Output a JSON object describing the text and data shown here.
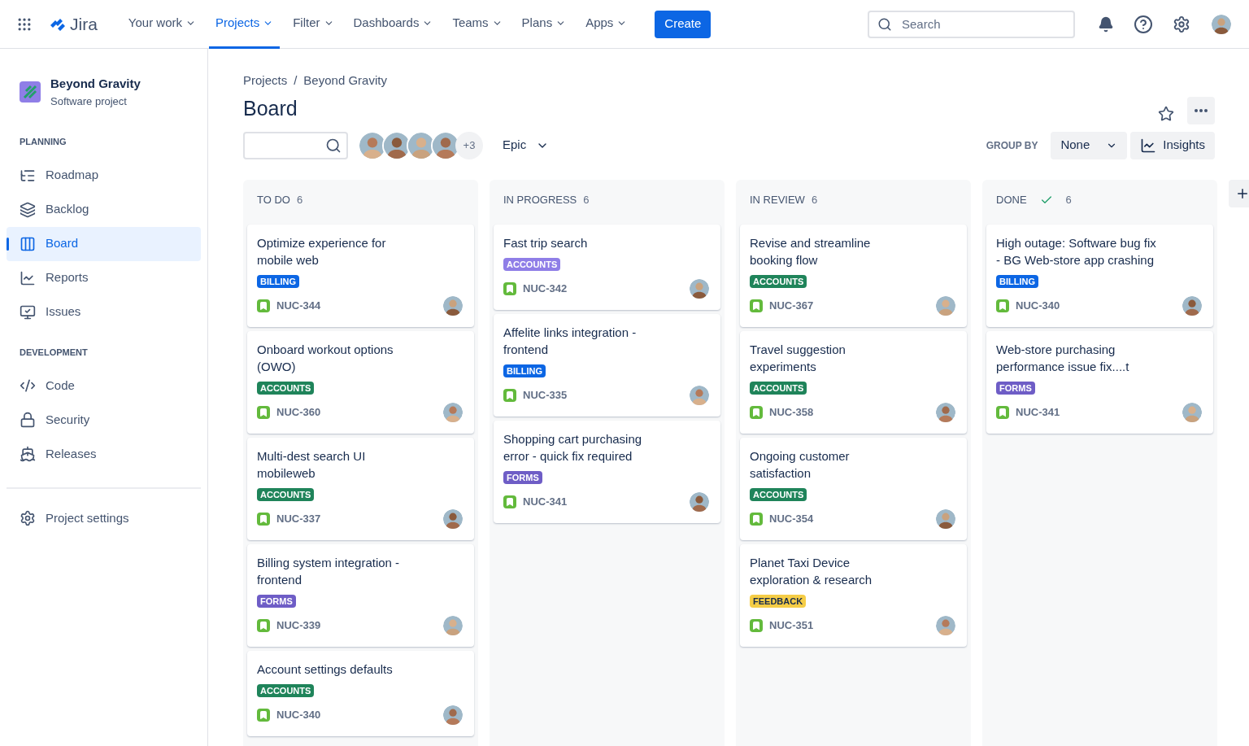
{
  "topnav": {
    "product": "Jira",
    "items": [
      {
        "label": "Your work",
        "selected": false
      },
      {
        "label": "Projects",
        "selected": true
      },
      {
        "label": "Filter",
        "selected": false
      },
      {
        "label": "Dashboards",
        "selected": false
      },
      {
        "label": "Teams",
        "selected": false
      },
      {
        "label": "Plans",
        "selected": false
      },
      {
        "label": "Apps",
        "selected": false
      }
    ],
    "create": "Create",
    "search": {
      "placeholder": "Search"
    }
  },
  "sidebar": {
    "project": {
      "name": "Beyond Gravity",
      "type": "Software project"
    },
    "sections": [
      {
        "heading": "PLANNING",
        "items": [
          {
            "label": "Roadmap",
            "kind": "roadmap",
            "selected": false
          },
          {
            "label": "Backlog",
            "kind": "backlog",
            "selected": false
          },
          {
            "label": "Board",
            "kind": "board",
            "selected": true
          },
          {
            "label": "Reports",
            "kind": "reports",
            "selected": false
          },
          {
            "label": "Issues",
            "kind": "issues",
            "selected": false
          }
        ]
      },
      {
        "heading": "DEVELOPMENT",
        "items": [
          {
            "label": "Code",
            "kind": "code",
            "selected": false
          },
          {
            "label": "Security",
            "kind": "security",
            "selected": false
          },
          {
            "label": "Releases",
            "kind": "releases",
            "selected": false
          }
        ]
      }
    ],
    "settings": "Project settings"
  },
  "breadcrumbs": [
    "Projects",
    "Beyond Gravity"
  ],
  "breadcrumb_separator": "/",
  "title": "Board",
  "toolbar": {
    "more_avatars": "+3",
    "epic": "Epic",
    "group_by_label": "GROUP BY",
    "group_by": "None",
    "insights": "Insights"
  },
  "columns": [
    {
      "name": "TO DO",
      "count": "6",
      "complete": false,
      "cards": [
        {
          "title": "Optimize experience for mobile web",
          "tag": {
            "label": "BILLING",
            "color": "#0c66e4"
          },
          "key": "NUC-344"
        },
        {
          "title": "Onboard workout options (OWO)",
          "tag": {
            "label": "ACCOUNTS",
            "color": "#1f845a"
          },
          "key": "NUC-360"
        },
        {
          "title": "Multi-dest search UI mobileweb",
          "tag": {
            "label": "ACCOUNTS",
            "color": "#1f845a"
          },
          "key": "NUC-337"
        },
        {
          "title": "Billing system integration - frontend",
          "tag": {
            "label": "FORMS",
            "color": "#6e5dc6"
          },
          "key": "NUC-339"
        },
        {
          "title": "Account settings defaults",
          "tag": {
            "label": "ACCOUNTS",
            "color": "#1f845a"
          },
          "key": "NUC-340"
        }
      ]
    },
    {
      "name": "IN PROGRESS",
      "count": "6",
      "complete": false,
      "cards": [
        {
          "title": "Fast trip search",
          "tag": {
            "label": "ACCOUNTS",
            "color": "#8f7ee7"
          },
          "key": "NUC-342"
        },
        {
          "title": "Affelite links integration - frontend",
          "tag": {
            "label": "BILLING",
            "color": "#0c66e4"
          },
          "key": "NUC-335"
        },
        {
          "title": "Shopping cart purchasing error - quick fix required",
          "tag": {
            "label": "FORMS",
            "color": "#6e5dc6"
          },
          "key": "NUC-341"
        }
      ]
    },
    {
      "name": "IN REVIEW",
      "count": "6",
      "complete": false,
      "cards": [
        {
          "title": "Revise and streamline booking flow",
          "tag": {
            "label": "ACCOUNTS",
            "color": "#1f845a"
          },
          "key": "NUC-367"
        },
        {
          "title": "Travel suggestion experiments",
          "tag": {
            "label": "ACCOUNTS",
            "color": "#1f845a"
          },
          "key": "NUC-358"
        },
        {
          "title": "Ongoing customer satisfaction",
          "tag": {
            "label": "ACCOUNTS",
            "color": "#1f845a"
          },
          "key": "NUC-354"
        },
        {
          "title": "Planet Taxi Device exploration & research",
          "tag": {
            "label": "FEEDBACK",
            "color": "#f5cd47"
          },
          "key": "NUC-351"
        }
      ]
    },
    {
      "name": "DONE",
      "count": "6",
      "complete": true,
      "cards": [
        {
          "title": "High outage: Software bug fix - BG Web-store app crashing",
          "tag": {
            "label": "BILLING",
            "color": "#0c66e4"
          },
          "key": "NUC-340"
        },
        {
          "title": "Web-store purchasing performance issue fix....t",
          "tag": {
            "label": "FORMS",
            "color": "#6e5dc6"
          },
          "key": "NUC-341"
        }
      ]
    }
  ]
}
